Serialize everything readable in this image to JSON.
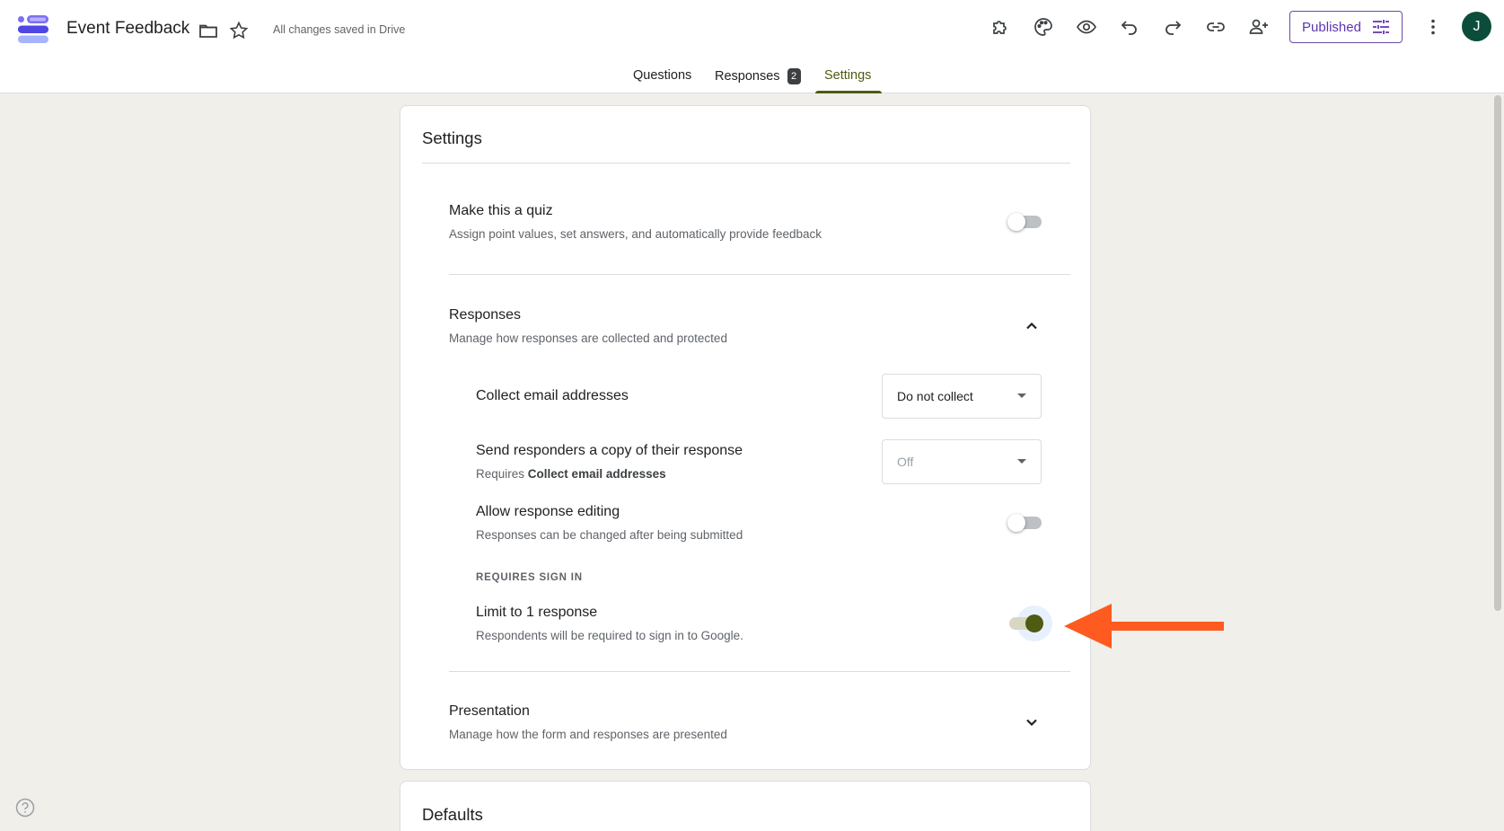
{
  "app": {
    "title": "Event Feedback",
    "save_status": "All changes saved in Drive",
    "publish_label": "Published",
    "avatar_letter": "J",
    "accent_color": "#4f5b13",
    "publish_color": "#5e35b1"
  },
  "tabs": [
    {
      "label": "Questions"
    },
    {
      "label": "Responses",
      "badge": "2"
    },
    {
      "label": "Settings",
      "active": true
    }
  ],
  "settings": {
    "title": "Settings",
    "quiz": {
      "title": "Make this a quiz",
      "subtitle": "Assign point values, set answers, and automatically provide feedback",
      "enabled": false
    },
    "responses": {
      "title": "Responses",
      "subtitle": "Manage how responses are collected and protected",
      "expanded": true,
      "collect_email": {
        "title": "Collect email addresses",
        "value": "Do not collect"
      },
      "send_copy": {
        "title": "Send responders a copy of their response",
        "requires_prefix": "Requires",
        "requires_bold": "Collect email addresses",
        "value": "Off",
        "disabled": true
      },
      "allow_editing": {
        "title": "Allow response editing",
        "subtitle": "Responses can be changed after being submitted",
        "enabled": false
      },
      "requires_sign_in_label": "REQUIRES SIGN IN",
      "limit_one": {
        "title": "Limit to 1 response",
        "subtitle": "Respondents will be required to sign in to Google.",
        "enabled": true
      }
    },
    "presentation": {
      "title": "Presentation",
      "subtitle": "Manage how the form and responses are presented",
      "expanded": false
    }
  },
  "defaults": {
    "title": "Defaults"
  },
  "annotation": {
    "arrow_color": "#ff5a1f"
  }
}
